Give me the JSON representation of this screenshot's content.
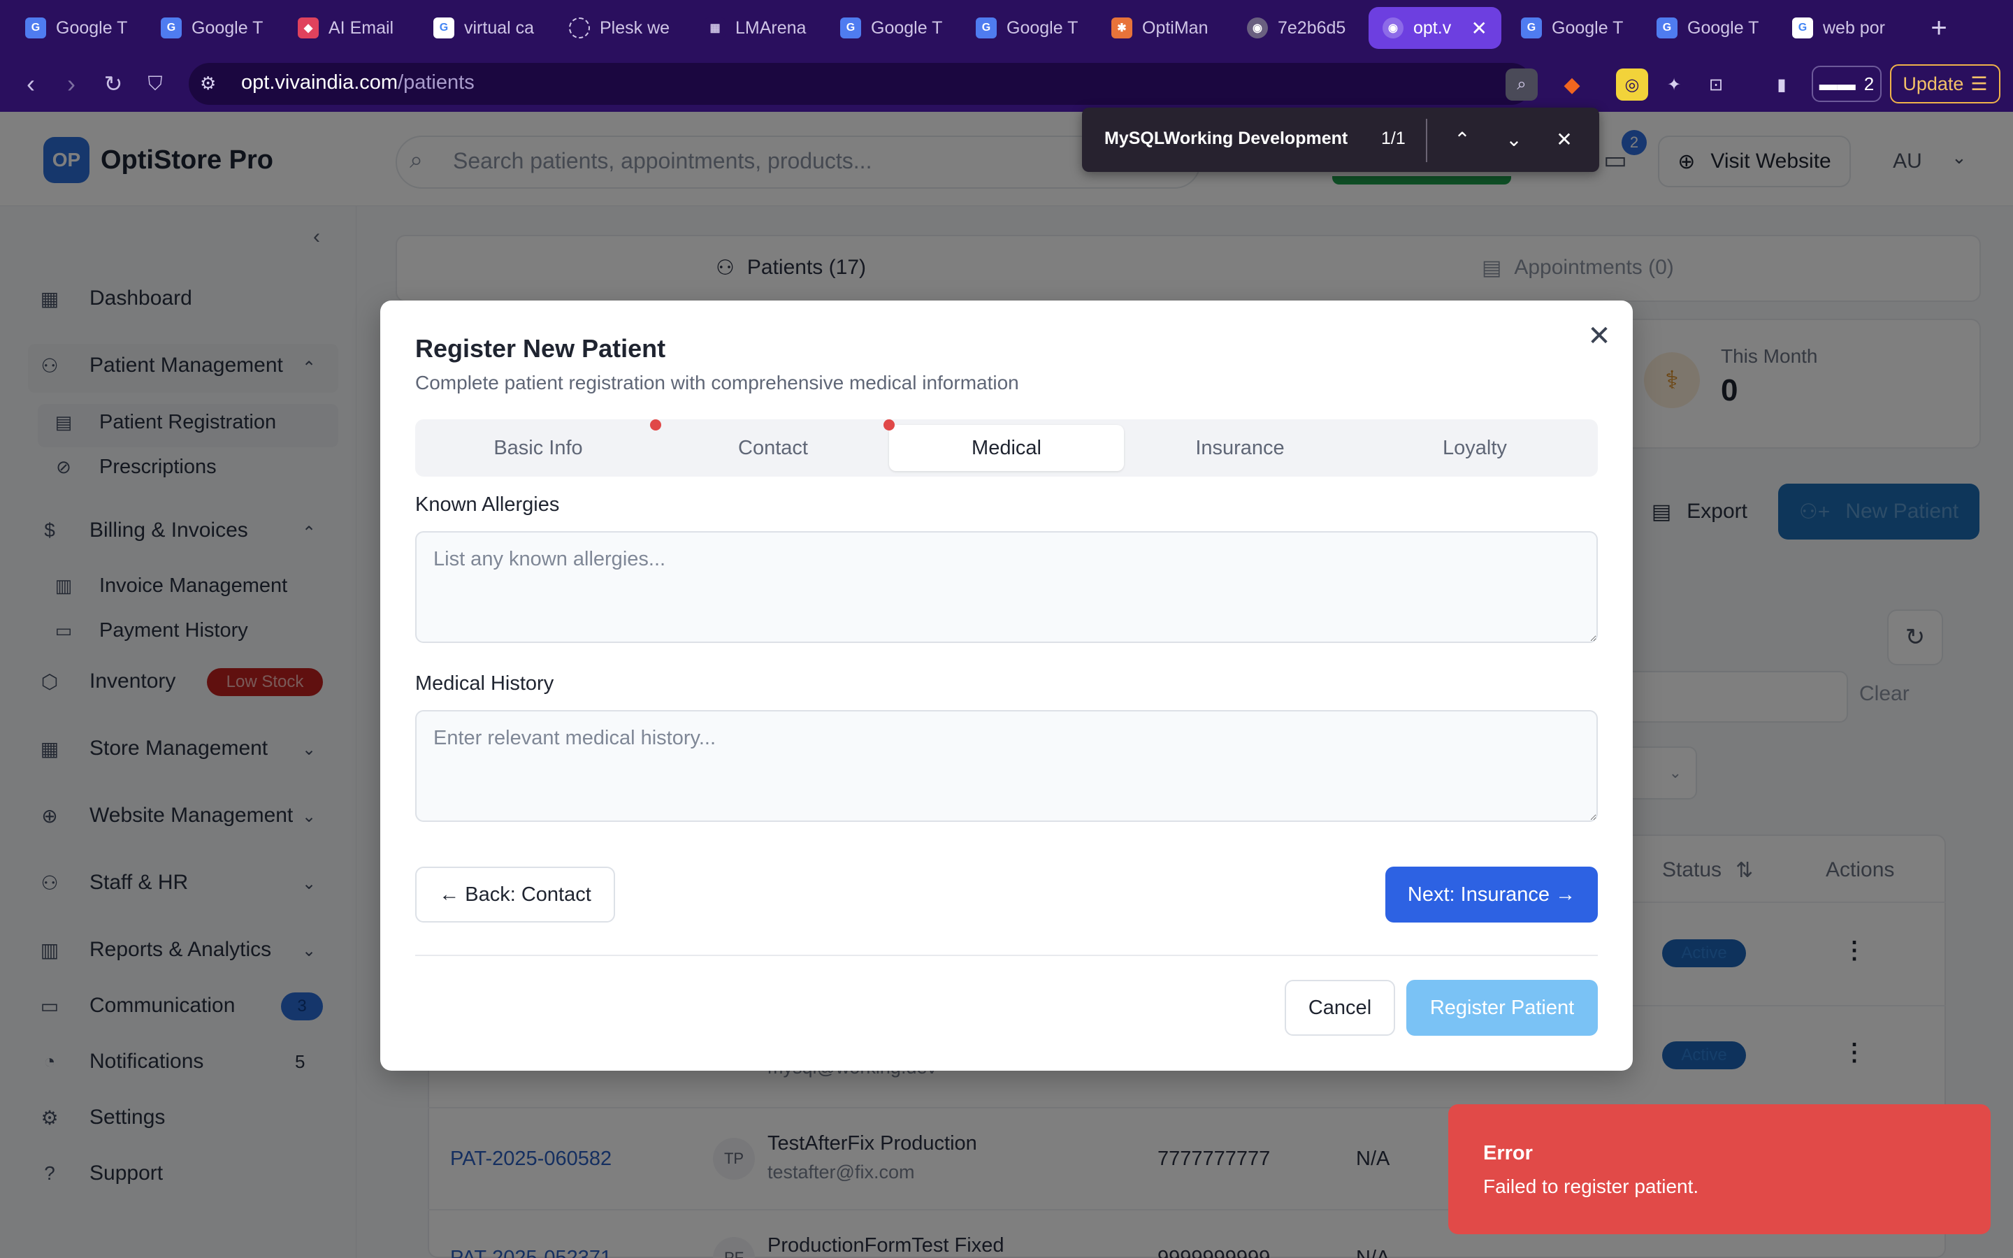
{
  "browser": {
    "tabs": [
      {
        "label": "Google T",
        "icon": "google-translate-icon",
        "color": "#4f7cf0"
      },
      {
        "label": "Google T",
        "icon": "google-translate-icon",
        "color": "#4f7cf0"
      },
      {
        "label": "AI Email",
        "icon": "ai-email-icon",
        "color": "#e0425d"
      },
      {
        "label": "virtual ca",
        "icon": "google-icon",
        "color": "#ffffff"
      },
      {
        "label": "Plesk we",
        "icon": "loading-icon",
        "color": "#2a0f5e"
      },
      {
        "label": "LMArena",
        "icon": "lmarena-icon",
        "color": "#2a0f5e"
      },
      {
        "label": "Google T",
        "icon": "google-translate-icon",
        "color": "#4f7cf0"
      },
      {
        "label": "Google T",
        "icon": "google-translate-icon",
        "color": "#4f7cf0"
      },
      {
        "label": "OptiMan",
        "icon": "optiman-icon",
        "color": "#e8733a"
      },
      {
        "label": "7e2b6d5",
        "icon": "globe-icon",
        "color": "#6a6080"
      },
      {
        "label": "opt.v",
        "icon": "globe-icon",
        "color": "#8d6be8",
        "active": true
      },
      {
        "label": "Google T",
        "icon": "google-translate-icon",
        "color": "#4f7cf0"
      },
      {
        "label": "Google T",
        "icon": "google-translate-icon",
        "color": "#4f7cf0"
      },
      {
        "label": "web por",
        "icon": "google-icon",
        "color": "#ffffff"
      }
    ],
    "new_tab": "+",
    "url_host": "opt.vivaindia.com",
    "url_path": "/patients",
    "extension_badge_count": "2",
    "update_label": "Update"
  },
  "find_bar": {
    "query": "MySQLWorking Development",
    "count": "1/1"
  },
  "app": {
    "logo_initials": "OP",
    "brand": "OptiStore Pro",
    "search_placeholder": "Search patients, appointments, products...",
    "chat_badge": "2",
    "visit_website": "Visit Website",
    "user_initials": "AU"
  },
  "sidebar": {
    "dashboard": "Dashboard",
    "patient_management": "Patient Management",
    "patient_registration": "Patient Registration",
    "prescriptions": "Prescriptions",
    "billing": "Billing & Invoices",
    "invoice_management": "Invoice Management",
    "payment_history": "Payment History",
    "inventory": "Inventory",
    "low_stock": "Low Stock",
    "store_management": "Store Management",
    "website_management": "Website Management",
    "staff_hr": "Staff & HR",
    "reports": "Reports & Analytics",
    "communication": "Communication",
    "communication_badge": "3",
    "notifications": "Notifications",
    "notifications_count": "5",
    "settings": "Settings",
    "support": "Support"
  },
  "main": {
    "tab_patients": "Patients (17)",
    "tab_appointments": "Appointments (0)",
    "stat_label": "This Month",
    "stat_value": "0",
    "export": "Export",
    "new_patient": "New Patient",
    "clear": "Clear",
    "th_status": "Status",
    "th_actions": "Actions",
    "rows": [
      {
        "status": "Active"
      },
      {
        "email": "mysql@working.dev",
        "status": "Active"
      },
      {
        "id": "PAT-2025-060582",
        "initials": "TP",
        "name": "TestAfterFix Production",
        "email": "testafter@fix.com",
        "phone": "7777777777",
        "na": "N/A"
      },
      {
        "id": "PAT-2025-052371",
        "initials": "PF",
        "name": "ProductionFormTest Fixed",
        "phone": "9999999999",
        "na": "N/A"
      }
    ]
  },
  "modal": {
    "title": "Register New Patient",
    "subtitle": "Complete patient registration with comprehensive medical information",
    "tabs": [
      "Basic Info",
      "Contact",
      "Medical",
      "Insurance",
      "Loyalty"
    ],
    "active_tab": "Medical",
    "allergies_label": "Known Allergies",
    "allergies_placeholder": "List any known allergies...",
    "allergies_value": "",
    "history_label": "Medical History",
    "history_placeholder": "Enter relevant medical history...",
    "history_value": "",
    "back_button": "← Back: Contact",
    "next_button": "Next: Insurance →",
    "cancel_button": "Cancel",
    "register_button": "Register Patient"
  },
  "toast": {
    "title": "Error",
    "message": "Failed to register patient."
  }
}
